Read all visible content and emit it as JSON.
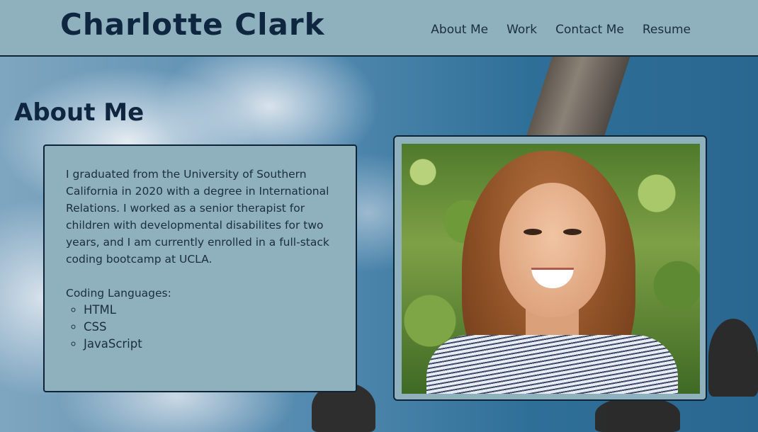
{
  "header": {
    "site_title": "Charlotte Clark",
    "nav": [
      "About Me",
      "Work",
      "Contact Me",
      "Resume"
    ]
  },
  "about": {
    "heading": "About Me",
    "bio": "I graduated from the University of Southern California in 2020 with a degree in International Relations. I worked as a senior therapist for children with developmental disabilites for two years, and I am currently enrolled in a full-stack coding bootcamp at UCLA.",
    "languages_label": "Coding Languages:",
    "languages": [
      "HTML",
      "CSS",
      "JavaScript"
    ]
  },
  "colors": {
    "panel": "#8eb1bd",
    "text_dark": "#0f2640",
    "border": "#0f2336"
  }
}
